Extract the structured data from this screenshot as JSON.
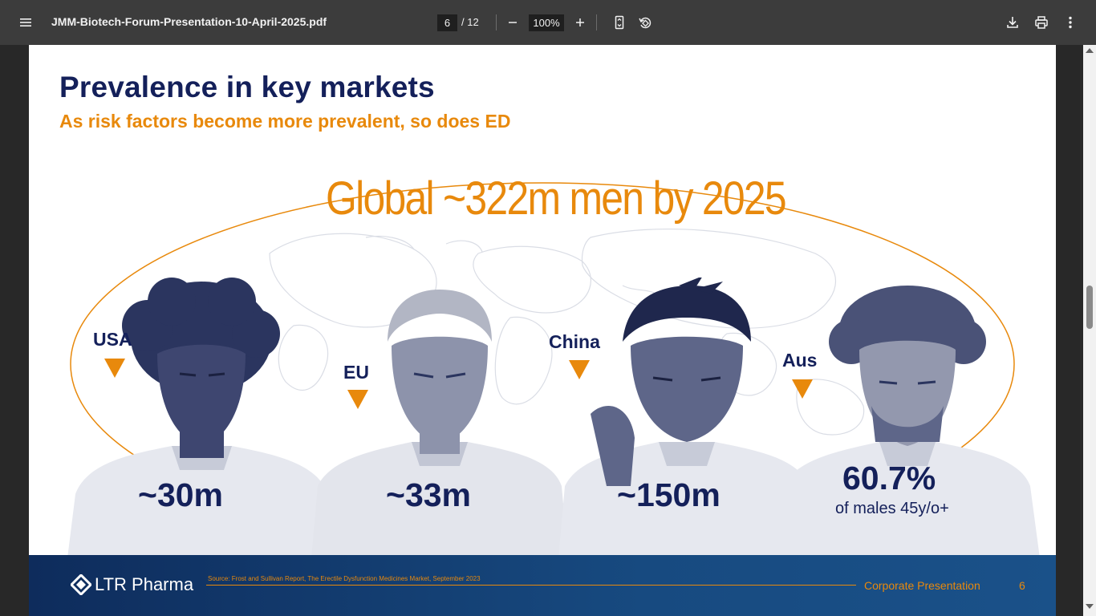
{
  "toolbar": {
    "menu_icon": "menu-icon",
    "title": "JMM-Biotech-Forum-Presentation-10-April-2025.pdf",
    "page_current": "6",
    "page_total": "/ 12",
    "zoom": "100%",
    "icons": [
      "zoom-out-icon",
      "zoom-in-icon",
      "fit-page-icon",
      "rotate-icon",
      "download-icon",
      "print-icon",
      "more-vert-icon"
    ]
  },
  "slide": {
    "title": "Prevalence in key markets",
    "subtitle": "As risk factors become more prevalent, so does ED",
    "global_label": "Global ~322m men by 2025",
    "markets": [
      {
        "region": "USA",
        "value": "~30m"
      },
      {
        "region": "EU",
        "value": "~33m"
      },
      {
        "region": "China",
        "value": "~150m"
      },
      {
        "region": "Aus",
        "value": "60.7%",
        "note": "of males 45y/o+"
      }
    ],
    "footer": {
      "logo_text": "LTR Pharma",
      "source": "Source: Frost and Sullivan Report, The Erectile Dysfunction Medicines Market, September 2023",
      "corporate": "Corporate Presentation",
      "page_number": "6"
    }
  },
  "colors": {
    "navy": "#14205a",
    "orange": "#e8890c",
    "toolbar": "#3c3c3c",
    "viewer_bg": "#282828"
  }
}
